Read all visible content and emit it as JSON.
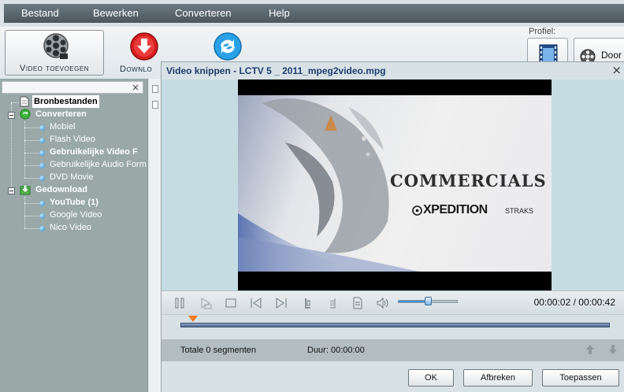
{
  "menu": {
    "items": [
      "Bestand",
      "Bewerken",
      "Converteren",
      "Help"
    ]
  },
  "toolbar": {
    "add_video_label": "Video toevoegen",
    "download_label": "Downlo"
  },
  "profile": {
    "label": "Profiel:",
    "door_label": "Door"
  },
  "sidebar": {
    "close_label": "×",
    "root_source": "Bronbestanden",
    "group_convert": "Converteren",
    "convert_items": [
      "Mobiel",
      "Flash Video",
      "Gebruikelijke Video F",
      "Gebruikelijke Audio Form",
      "DVD Movie"
    ],
    "group_downloaded": "Gedownload",
    "download_items": [
      "YouTube (1)",
      "Google Video",
      "Nico Video"
    ]
  },
  "dialog": {
    "title": "Video knippen - LCTV 5 _ 2011_mpeg2video.mpg",
    "close_label": "×",
    "video_frame": {
      "headline": "COMMERCIALS",
      "brand": "XPEDITION",
      "tag": "STRAKS"
    },
    "time_display": "00:00:02 / 00:00:42",
    "volume_level": 0.5,
    "playhead_position": 0.03,
    "segments_total": "Totale 0 segmenten",
    "segments_duration": "Duur: 00:00:00",
    "buttons": {
      "ok": "OK",
      "cancel": "Afbreken",
      "apply": "Toepassen"
    }
  },
  "colors": {
    "menubar": "#5a656c",
    "sidebar": "#9aa8a8",
    "dialog_title": "#1f3c6e",
    "timeline_marker": "#f07a1e",
    "progress": "#3a8fd8"
  }
}
